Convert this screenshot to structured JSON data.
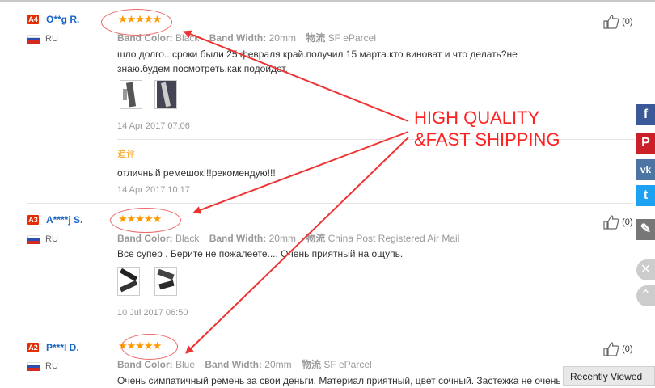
{
  "reviews": [
    {
      "level": "A4",
      "name": "O**g R.",
      "country": "RU",
      "stars": "★★★★★",
      "band_color_label": "Band Color:",
      "band_color": "Black",
      "band_width_label": "Band Width:",
      "band_width": "20mm",
      "logistics_label": "物流",
      "logistics": "SF eParcel",
      "text": "шло долго...сроки были 25 февраля край.получил 15 марта.кто виноват и что делать?не знаю.будем посмотреть,как подойдет.",
      "date": "14 Apr 2017 07:06",
      "additional_label": "追评",
      "additional_text": "отличный ремешок!!!рекомендую!!!",
      "additional_date": "14 Apr 2017 10:17",
      "likes": "(0)"
    },
    {
      "level": "A3",
      "name": "A****j S.",
      "country": "RU",
      "stars": "★★★★★",
      "band_color_label": "Band Color:",
      "band_color": "Black",
      "band_width_label": "Band Width:",
      "band_width": "20mm",
      "logistics_label": "物流",
      "logistics": "China Post Registered Air Mail",
      "text": "Все супер . Берите не пожалеете.... Очень приятный на ощупь.",
      "date": "10 Jul 2017 06:50",
      "likes": "(0)"
    },
    {
      "level": "A2",
      "name": "P***l D.",
      "country": "RU",
      "stars": "★★★★★",
      "band_color_label": "Band Color:",
      "band_color": "Blue",
      "band_width_label": "Band Width:",
      "band_width": "20mm",
      "logistics_label": "物流",
      "logistics": "SF eParcel",
      "text": "Очень симпатичный ремень за свои деньги. Материал приятный, цвет сочный. Застежка не очень",
      "likes": "(0)"
    }
  ],
  "overlay": {
    "line1": "HIGH QUALITY",
    "line2": "&FAST SHIPPING"
  },
  "social": [
    {
      "icon": "facebook-icon",
      "glyph": "f",
      "color": "#3b5998"
    },
    {
      "icon": "pinterest-icon",
      "glyph": "P",
      "color": "#cb2027"
    },
    {
      "icon": "vk-icon",
      "glyph": "vk",
      "color": "#4c75a3"
    },
    {
      "icon": "twitter-icon",
      "glyph": "t",
      "color": "#1da1f2"
    },
    {
      "icon": "edit-icon",
      "glyph": "✎",
      "color": "#777777"
    }
  ],
  "recently_viewed": "Recently Viewed",
  "colors": {
    "accent": "#ff9a00",
    "annotation": "#ff2222",
    "level_badge": "#e62e04",
    "name_link": "#1a66c5"
  }
}
